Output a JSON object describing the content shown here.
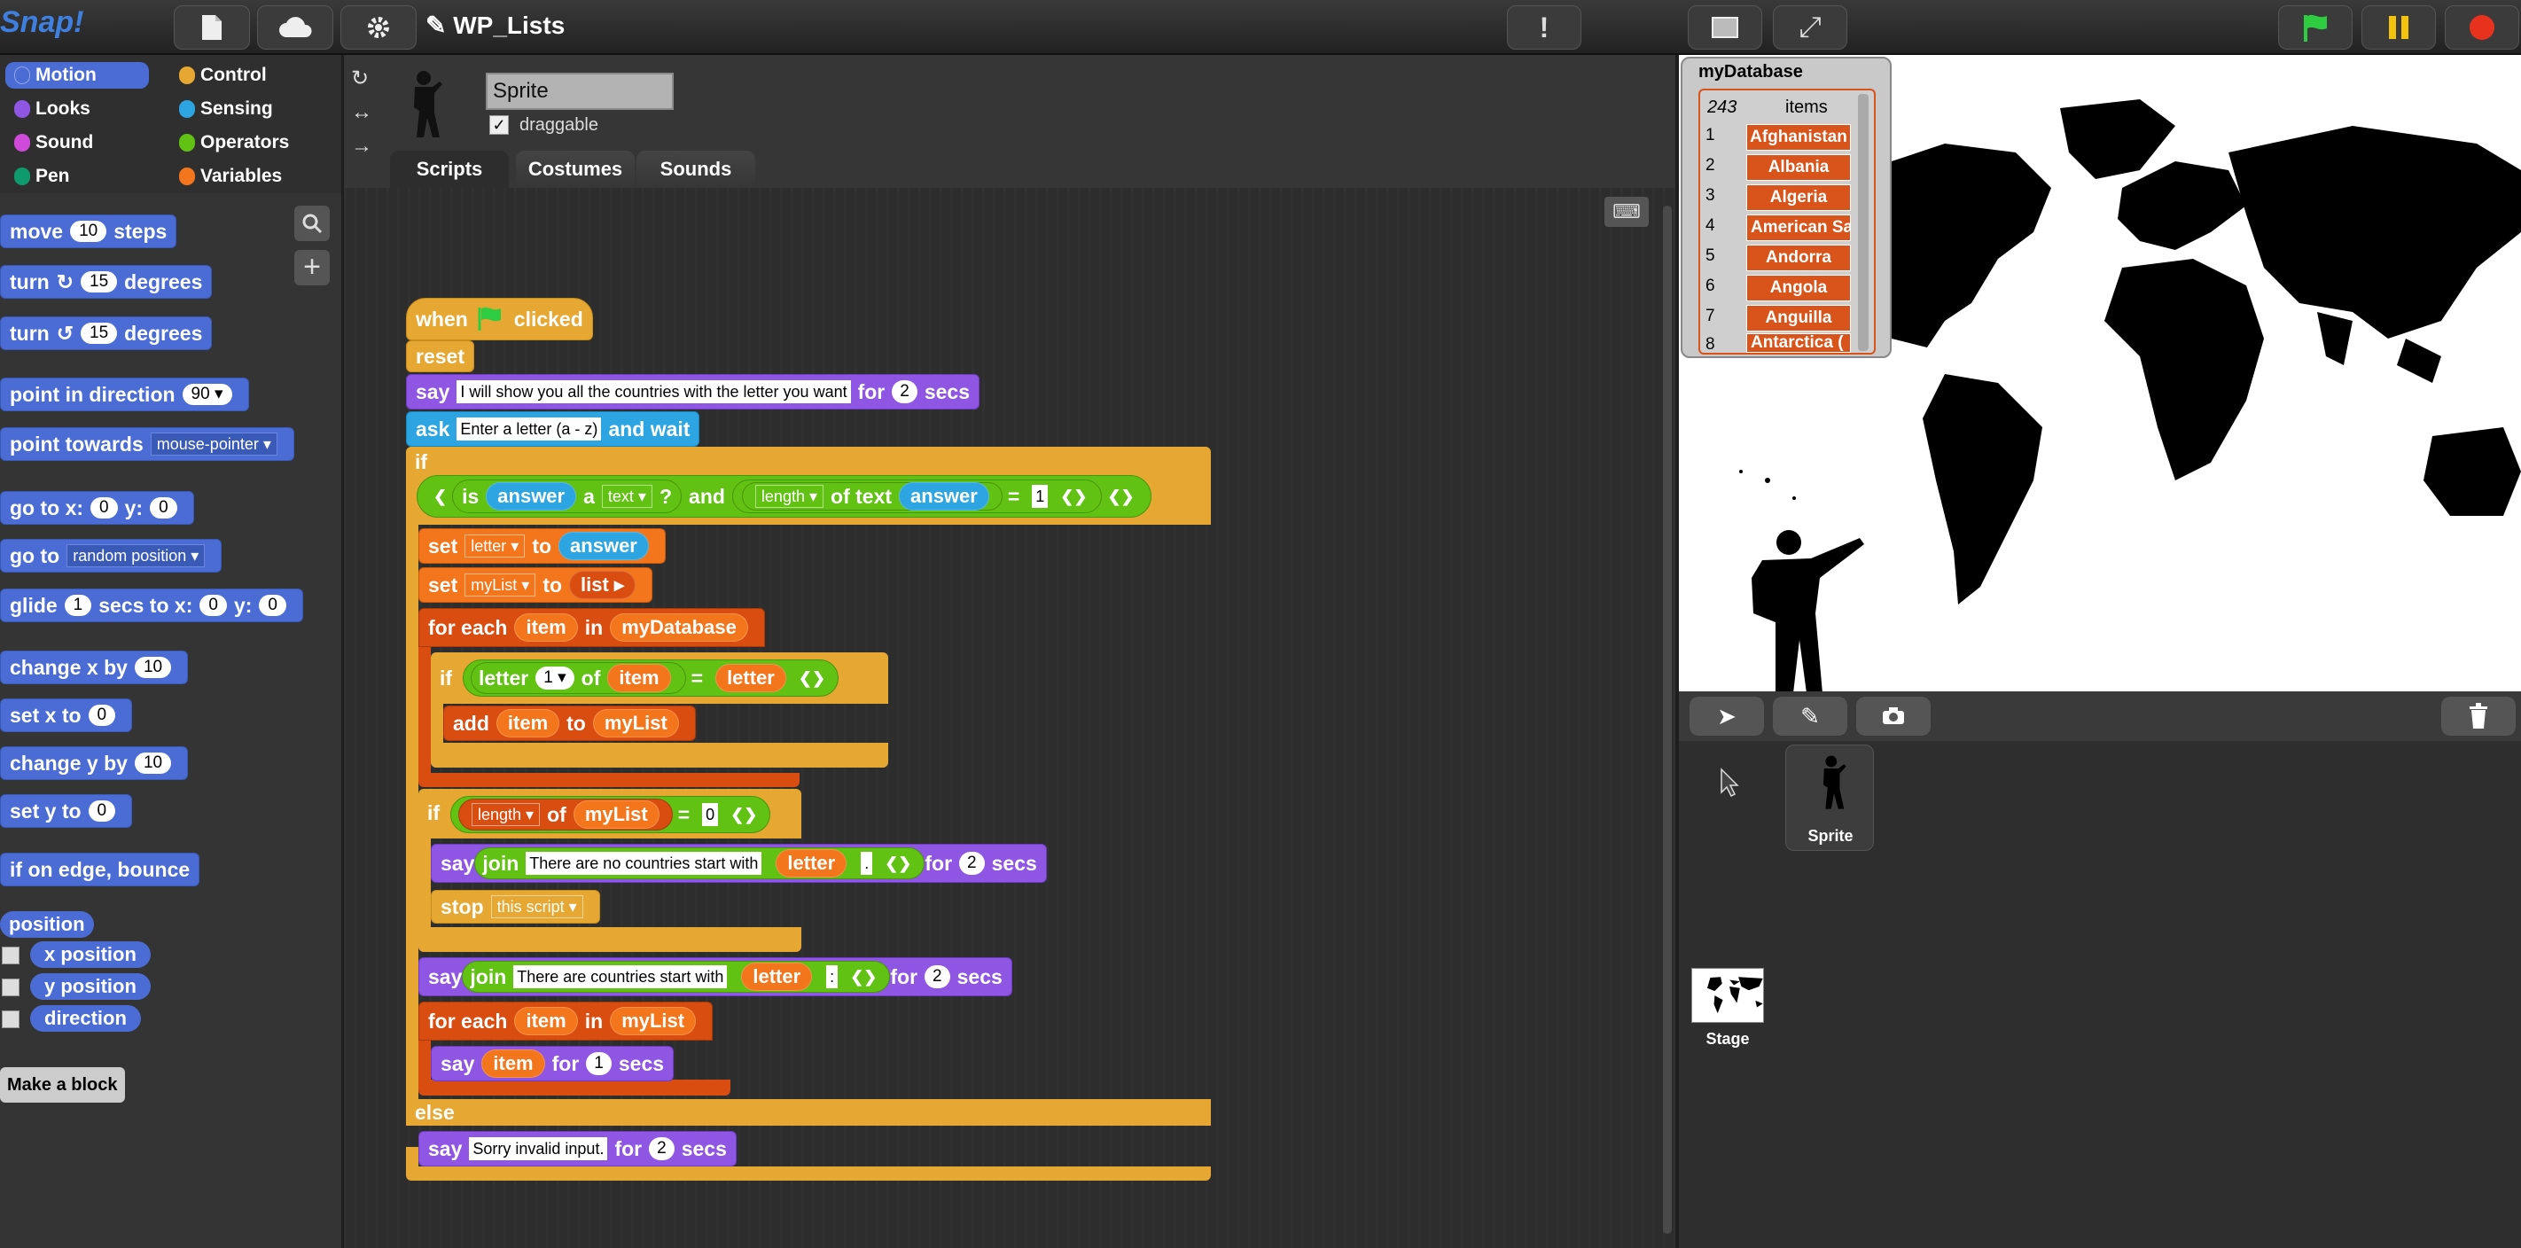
{
  "app": {
    "project_title": "WP_Lists"
  },
  "topbar": {
    "file_icon": "file-icon",
    "cloud_icon": "cloud-icon",
    "settings_icon": "gear-icon"
  },
  "categories": [
    {
      "label": "Motion",
      "color": "#4a6cd4"
    },
    {
      "label": "Looks",
      "color": "#8f56e3"
    },
    {
      "label": "Sound",
      "color": "#cf4ad9"
    },
    {
      "label": "Pen",
      "color": "#0e9a6c"
    },
    {
      "label": "Control",
      "color": "#e6a832"
    },
    {
      "label": "Sensing",
      "color": "#2ca5e2"
    },
    {
      "label": "Operators",
      "color": "#62c213"
    },
    {
      "label": "Variables",
      "color": "#f3761d"
    }
  ],
  "palette": {
    "move": {
      "pre": "move",
      "val": "10",
      "post": "steps"
    },
    "turn_cw": {
      "pre": "turn",
      "val": "15",
      "post": "degrees"
    },
    "turn_ccw": {
      "pre": "turn",
      "val": "15",
      "post": "degrees"
    },
    "point_dir": {
      "pre": "point in direction",
      "val": "90"
    },
    "point_towards": {
      "pre": "point towards",
      "val": "mouse-pointer"
    },
    "goto_xy": {
      "pre": "go to x:",
      "x": "0",
      "mid": "y:",
      "y": "0"
    },
    "goto": {
      "pre": "go to",
      "val": "random position"
    },
    "glide": {
      "pre": "glide",
      "secs": "1",
      "mid": "secs to x:",
      "x": "0",
      "mid2": "y:",
      "y": "0"
    },
    "change_x": {
      "pre": "change x by",
      "val": "10"
    },
    "set_x": {
      "pre": "set x to",
      "val": "0"
    },
    "change_y": {
      "pre": "change y by",
      "val": "10"
    },
    "set_y": {
      "pre": "set y to",
      "val": "0"
    },
    "bounce": "if on edge, bounce",
    "position": "position",
    "x_position": "x position",
    "y_position": "y position",
    "direction": "direction",
    "make_block": "Make a block"
  },
  "sprite": {
    "name": "Sprite",
    "draggable_label": "draggable",
    "draggable_checked": "✓"
  },
  "tabs": [
    "Scripts",
    "Costumes",
    "Sounds"
  ],
  "script": {
    "hat": {
      "when": "when",
      "clicked": "clicked"
    },
    "reset": "reset",
    "say1": {
      "say": "say",
      "text": "I will show you all the countries with the letter you want",
      "for": "for",
      "secs_val": "2",
      "secs": "secs"
    },
    "ask": {
      "ask": "ask",
      "text": "Enter a letter (a - z)",
      "wait": "and wait"
    },
    "if1": {
      "if": "if",
      "is": "is",
      "answer": "answer",
      "a": "a",
      "type": "text",
      "q": "?",
      "and": "and",
      "length": "length",
      "oftext": "of text",
      "answer2": "answer",
      "eq": "=",
      "num": "1"
    },
    "set_letter": {
      "set": "set",
      "var": "letter",
      "to": "to",
      "val": "answer"
    },
    "set_mylist": {
      "set": "set",
      "var": "myList",
      "to": "to",
      "val": "list"
    },
    "foreach1": {
      "for": "for each",
      "item": "item",
      "in": "in",
      "list": "myDatabase"
    },
    "if2": {
      "if": "if",
      "letter": "letter",
      "idx": "1",
      "of": "of",
      "item": "item",
      "eq": "=",
      "letter2": "letter"
    },
    "add": {
      "add": "add",
      "item": "item",
      "to": "to",
      "list": "myList"
    },
    "if3": {
      "if": "if",
      "length": "length",
      "of": "of",
      "list": "myList",
      "eq": "=",
      "num": "0"
    },
    "say2": {
      "say": "say",
      "join": "join",
      "text": "There are no countries start with",
      "letter": "letter",
      "for": "for",
      "secs_val": "2",
      "secs": "secs"
    },
    "stop": {
      "stop": "stop",
      "val": "this script"
    },
    "say3": {
      "say": "say",
      "join": "join",
      "text": "There are countries start with",
      "letter": "letter",
      "for": "for",
      "secs_val": "2",
      "secs": "secs"
    },
    "foreach2": {
      "for": "for each",
      "item": "item",
      "in": "in",
      "list": "myList"
    },
    "say4": {
      "say": "say",
      "item": "item",
      "for": "for",
      "secs_val": "1",
      "secs": "secs"
    },
    "else": "else",
    "say5": {
      "say": "say",
      "text": "Sorry invalid input.",
      "for": "for",
      "secs_val": "2",
      "secs": "secs"
    }
  },
  "watcher": {
    "title": "myDatabase",
    "count": "243",
    "items_label": "items",
    "rows": [
      {
        "i": "1",
        "v": "Afghanistan"
      },
      {
        "i": "2",
        "v": "Albania"
      },
      {
        "i": "3",
        "v": "Algeria"
      },
      {
        "i": "4",
        "v": "American Samoa"
      },
      {
        "i": "5",
        "v": "Andorra"
      },
      {
        "i": "6",
        "v": "Angola"
      },
      {
        "i": "7",
        "v": "Anguilla"
      },
      {
        "i": "8",
        "v": "Antarctica ("
      }
    ]
  },
  "corral": {
    "sprite_label": "Sprite",
    "stage_label": "Stage"
  }
}
